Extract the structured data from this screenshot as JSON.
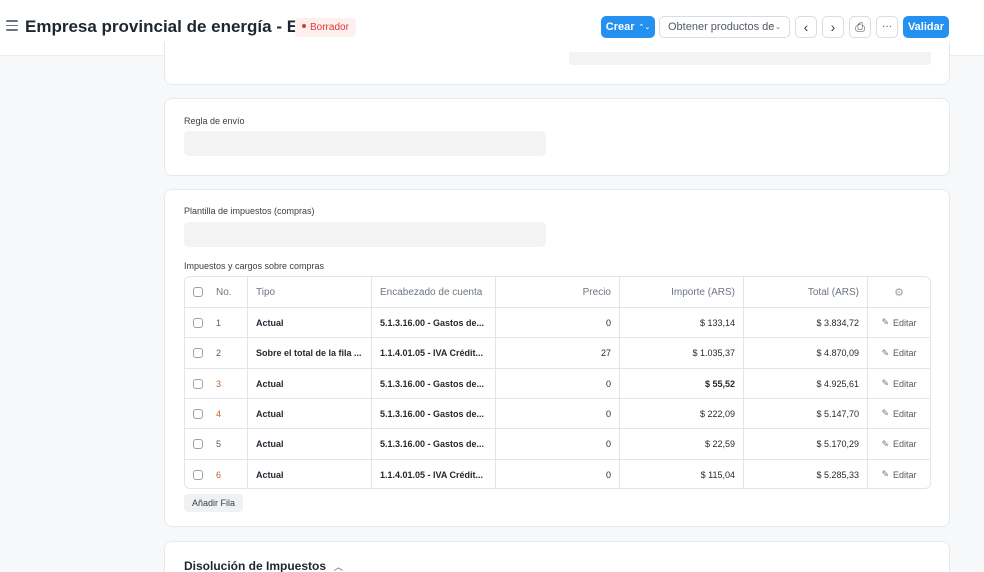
{
  "header": {
    "title": "Empresa provincial de energía - EPE",
    "status": "Borrador",
    "buttons": {
      "crear": "Crear",
      "obtener": "Obtener productos de",
      "prev": "‹",
      "next": "›",
      "print": "⎙",
      "more": "···",
      "validar": "Validar"
    }
  },
  "form": {
    "regla_envio": {
      "label": "Regla de envío",
      "value": ""
    },
    "plantilla_impuestos": {
      "label": "Plantilla de impuestos (compras)",
      "value": ""
    },
    "taxes_table": {
      "label": "Impuestos y cargos sobre compras",
      "columns": [
        "No.",
        "Tipo",
        "Encabezado de cuenta",
        "Precio",
        "Importe (ARS)",
        "Total (ARS)"
      ],
      "rows": [
        {
          "no": "1",
          "tipo": "Actual",
          "cuenta": "5.1.3.16.00 - Gastos de...",
          "precio": "0",
          "importe": "$ 133,14",
          "total": "$ 3.834,72",
          "edit": "Editar"
        },
        {
          "no": "2",
          "tipo": "Sobre el total de la fila ...",
          "cuenta": "1.1.4.01.05 - IVA Crédit...",
          "precio": "27",
          "importe": "$ 1.035,37",
          "total": "$ 4.870,09",
          "edit": "Editar"
        },
        {
          "no": "3",
          "tipo": "Actual",
          "cuenta": "5.1.3.16.00 - Gastos de...",
          "precio": "0",
          "importe": "$ 55,52",
          "total": "$ 4.925,61",
          "edit": "Editar"
        },
        {
          "no": "4",
          "tipo": "Actual",
          "cuenta": "5.1.3.16.00 - Gastos de...",
          "precio": "0",
          "importe": "$ 222,09",
          "total": "$ 5.147,70",
          "edit": "Editar"
        },
        {
          "no": "5",
          "tipo": "Actual",
          "cuenta": "5.1.3.16.00 - Gastos de...",
          "precio": "0",
          "importe": "$ 22,59",
          "total": "$ 5.170,29",
          "edit": "Editar"
        },
        {
          "no": "6",
          "tipo": "Actual",
          "cuenta": "1.1.4.01.05 - IVA Crédit...",
          "precio": "0",
          "importe": "$ 115,04",
          "total": "$ 5.285,33",
          "edit": "Editar"
        }
      ],
      "add_row": "Añadir Fila"
    },
    "disolucion": {
      "title": "Disolución de Impuestos"
    }
  },
  "colors": {
    "primary": "#2490ef",
    "status_red": "#e03636",
    "row_number_orange": "#c2632b"
  }
}
